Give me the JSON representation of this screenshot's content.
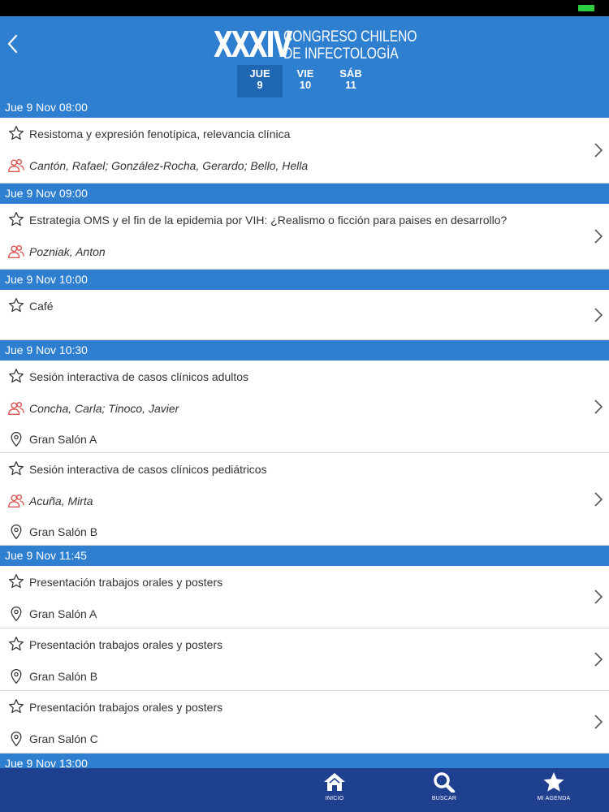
{
  "app": {
    "logo_number": "XXXIV",
    "logo_line1": "CONGRESO CHILENO",
    "logo_line2": "DE INFECTOLOGÍA",
    "colors": {
      "header": "#2f7fd0",
      "active_tab": "#1f66b3",
      "tabbar": "#1f3f8f",
      "speaker_icon": "#d9534f"
    }
  },
  "day_tabs": [
    {
      "day": "JUE",
      "num": "9",
      "active": true
    },
    {
      "day": "VIE",
      "num": "10",
      "active": false
    },
    {
      "day": "SÁB",
      "num": "11",
      "active": false
    }
  ],
  "sections": [
    {
      "header": "Jue 9 Nov 08:00",
      "items": [
        {
          "title": "Resistoma y expresión fenotípica, relevancia clínica",
          "speakers": "Cantón, Rafael; González-Rocha, Gerardo; Bello, Hella",
          "location": ""
        }
      ]
    },
    {
      "header": "Jue 9 Nov 09:00",
      "items": [
        {
          "title": "Estrategia OMS y el fin de la epidemia por VIH: ¿Realismo o ficción para paises en desarrollo?",
          "speakers": "Pozniak, Anton",
          "location": ""
        }
      ]
    },
    {
      "header": "Jue 9 Nov 10:00",
      "items": [
        {
          "title": "Café",
          "speakers": "",
          "location": ""
        }
      ]
    },
    {
      "header": "Jue 9 Nov 10:30",
      "items": [
        {
          "title": "Sesión interactiva de casos clínicos adultos",
          "speakers": "Concha, Carla; Tinoco, Javier",
          "location": "Gran Salón A"
        },
        {
          "title": "Sesión interactiva de casos clínicos pediátricos",
          "speakers": "Acuña, Mirta",
          "location": "Gran Salón B"
        }
      ]
    },
    {
      "header": "Jue 9 Nov 11:45",
      "items": [
        {
          "title": "Presentación trabajos orales y posters",
          "speakers": "",
          "location": "Gran Salón A"
        },
        {
          "title": "Presentación trabajos orales y posters",
          "speakers": "",
          "location": "Gran Salón B"
        },
        {
          "title": "Presentación trabajos orales y posters",
          "speakers": "",
          "location": "Gran Salón C"
        }
      ]
    },
    {
      "header": "Jue 9 Nov 13:00",
      "items": []
    }
  ],
  "tabbar": [
    {
      "label": "INICIO",
      "icon": "home-icon"
    },
    {
      "label": "BUSCAR",
      "icon": "search-icon"
    },
    {
      "label": "MI AGENDA",
      "icon": "star-icon"
    }
  ]
}
